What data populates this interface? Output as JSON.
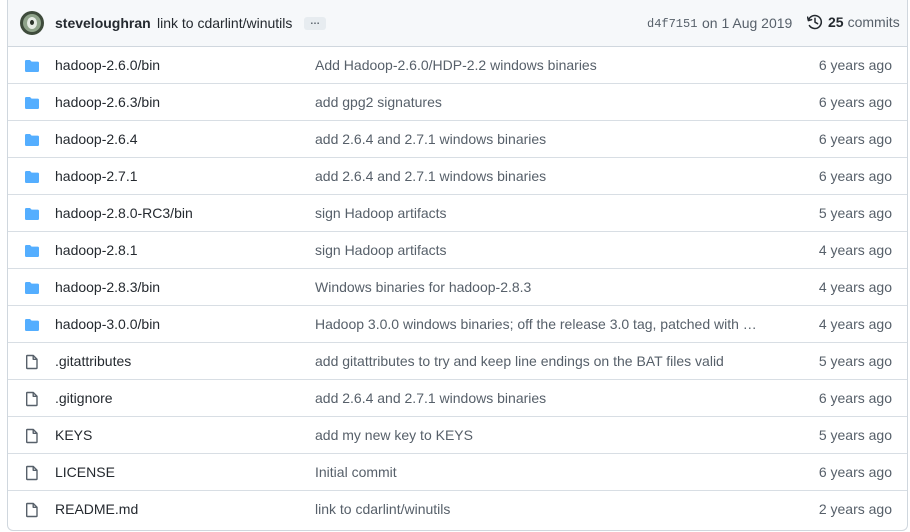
{
  "commit": {
    "author": "steveloughran",
    "message": "link to cdarlint/winutils",
    "ellipsis": "…",
    "sha": "d4f7151",
    "date": "on 1 Aug 2019",
    "commit_count": "25",
    "commits_label": "commits"
  },
  "colors": {
    "folder": "#54aeff",
    "file": "#57606a",
    "muted": "#57606a"
  },
  "files": [
    {
      "type": "folder",
      "name": "hadoop-2.6.0/bin",
      "message": "Add Hadoop-2.6.0/HDP-2.2 windows binaries",
      "age": "6 years ago"
    },
    {
      "type": "folder",
      "name": "hadoop-2.6.3/bin",
      "message": "add gpg2 signatures",
      "age": "6 years ago"
    },
    {
      "type": "folder",
      "name": "hadoop-2.6.4",
      "message": "add 2.6.4 and 2.7.1 windows binaries",
      "age": "6 years ago"
    },
    {
      "type": "folder",
      "name": "hadoop-2.7.1",
      "message": "add 2.6.4 and 2.7.1 windows binaries",
      "age": "6 years ago"
    },
    {
      "type": "folder",
      "name": "hadoop-2.8.0-RC3/bin",
      "message": "sign Hadoop artifacts",
      "age": "5 years ago"
    },
    {
      "type": "folder",
      "name": "hadoop-2.8.1",
      "message": "sign Hadoop artifacts",
      "age": "4 years ago"
    },
    {
      "type": "folder",
      "name": "hadoop-2.8.3/bin",
      "message": "Windows binaries for hadoop-2.8.3",
      "age": "4 years ago"
    },
    {
      "type": "folder",
      "name": "hadoop-3.0.0/bin",
      "message": "Hadoop 3.0.0 windows binaries; off the release 3.0 tag, patched with …",
      "age": "4 years ago"
    },
    {
      "type": "file",
      "name": ".gitattributes",
      "message": "add gitattributes to try and keep line endings on the BAT files valid",
      "age": "5 years ago"
    },
    {
      "type": "file",
      "name": ".gitignore",
      "message": "add 2.6.4 and 2.7.1 windows binaries",
      "age": "6 years ago"
    },
    {
      "type": "file",
      "name": "KEYS",
      "message": "add my new key to KEYS",
      "age": "5 years ago"
    },
    {
      "type": "file",
      "name": "LICENSE",
      "message": "Initial commit",
      "age": "6 years ago"
    },
    {
      "type": "file",
      "name": "README.md",
      "message": "link to cdarlint/winutils",
      "age": "2 years ago"
    }
  ]
}
